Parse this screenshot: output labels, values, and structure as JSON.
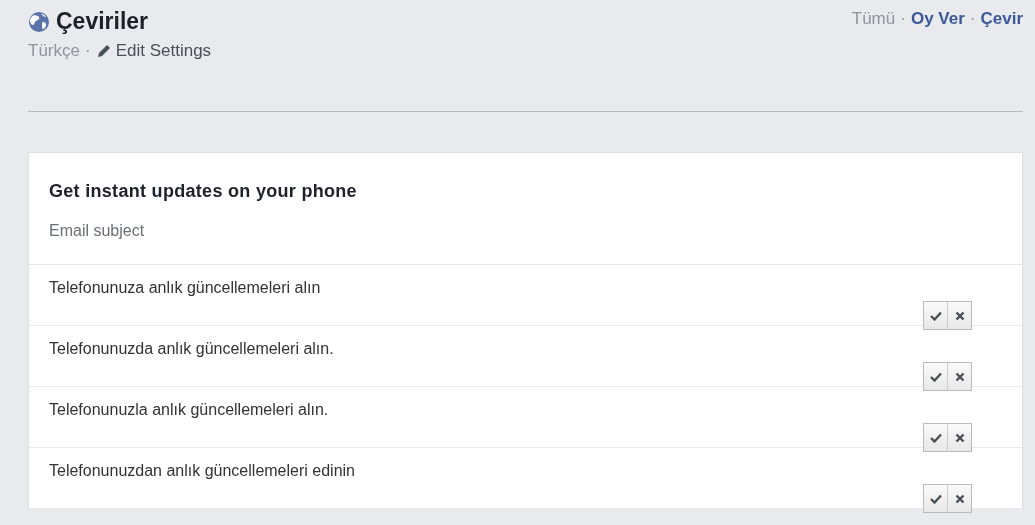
{
  "header": {
    "title": "Çeviriler",
    "language": "Türkçe",
    "separator": "·",
    "edit_link": "Edit Settings"
  },
  "nav_separator": "·",
  "nav": [
    {
      "label": "Tümü",
      "selected": true
    },
    {
      "label": "Oy Ver",
      "selected": false
    },
    {
      "label": "Çevir",
      "selected": false
    }
  ],
  "card": {
    "heading": "Get instant updates on your phone",
    "subtitle": "Email subject",
    "translations": [
      {
        "text": "Telefonunuza anlık güncellemeleri alın"
      },
      {
        "text": "Telefonunuzda anlık güncellemeleri alın."
      },
      {
        "text": "Telefonunuzla anlık güncellemeleri alın."
      },
      {
        "text": "Telefonunuzdan anlık güncellemeleri edinin"
      }
    ]
  }
}
